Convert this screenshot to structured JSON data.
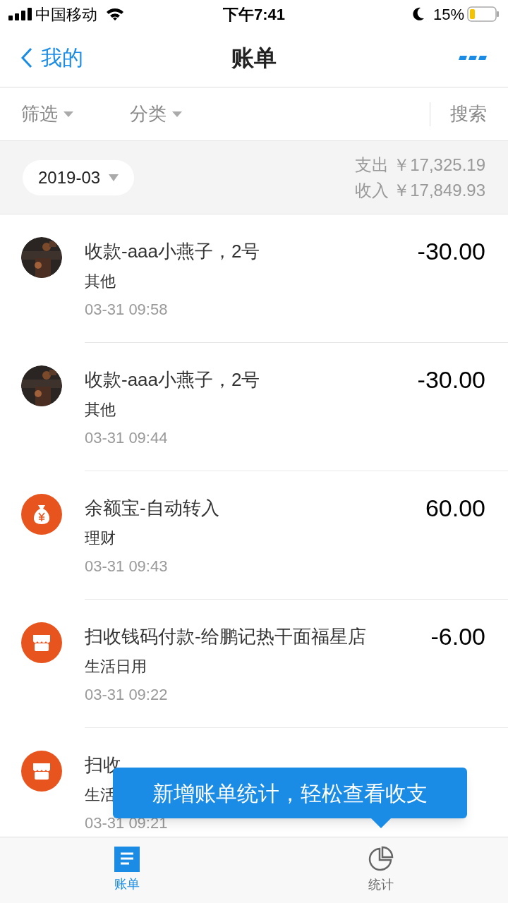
{
  "status_bar": {
    "carrier": "中国移动",
    "time": "下午7:41",
    "battery": "15%"
  },
  "nav": {
    "back": "我的",
    "title": "账单"
  },
  "filters": [
    {
      "label": "筛选"
    },
    {
      "label": "分类"
    }
  ],
  "search": "搜索",
  "summary": {
    "month": "2019-03",
    "expense": "支出 ￥17,325.19",
    "income": "收入 ￥17,849.93"
  },
  "bills": [
    {
      "title": "收款-aaa小燕子，2号",
      "category": "其他",
      "time": "03-31  09:58",
      "amount": "-30.00"
    },
    {
      "title": "收款-aaa小燕子，2号",
      "category": "其他",
      "time": "03-31  09:44",
      "amount": "-30.00"
    },
    {
      "kind": "money-bag",
      "title": "余额宝-自动转入",
      "category": "理财",
      "time": "03-31  09:43",
      "amount": "60.00"
    },
    {
      "kind": "shop",
      "title": "扫收钱码付款-给鹏记热干面福星店",
      "category": "生活日用",
      "time": "03-31  09:22",
      "amount": "-6.00"
    },
    {
      "kind": "shop",
      "title": "扫收",
      "category": "生活",
      "time": "03-31  09:21"
    }
  ],
  "tooltip": "新增账单统计，轻松查看收支",
  "tabs": [
    {
      "label": "账单",
      "kind": "list",
      "selected": true
    },
    {
      "label": "统计",
      "kind": "chart",
      "selected": false
    }
  ]
}
